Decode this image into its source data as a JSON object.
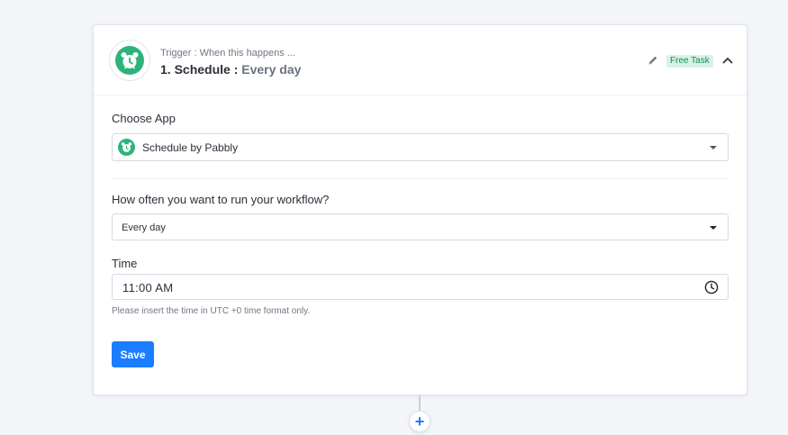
{
  "header": {
    "trigger_label": "Trigger : When this happens ...",
    "step_title": "1. Schedule : ",
    "step_sub": "Every day",
    "badge": "Free Task",
    "icons": {
      "logo": "alarm-clock-icon",
      "edit": "pencil-icon",
      "collapse": "chevron-up-icon"
    }
  },
  "form": {
    "choose_app_label": "Choose App",
    "app_value": "Schedule by Pabbly",
    "frequency_label": "How often you want to run your workflow?",
    "frequency_value": "Every day",
    "time_label": "Time",
    "time_value": "11:00 AM",
    "time_hint": "Please insert the time in UTC +0 time format only.",
    "save_label": "Save"
  },
  "footer": {
    "add_label": "+"
  },
  "colors": {
    "accent": "#1a7cff",
    "app_green": "#2db37a",
    "badge_bg": "#d6f3e6",
    "badge_text": "#1d8a5a"
  }
}
